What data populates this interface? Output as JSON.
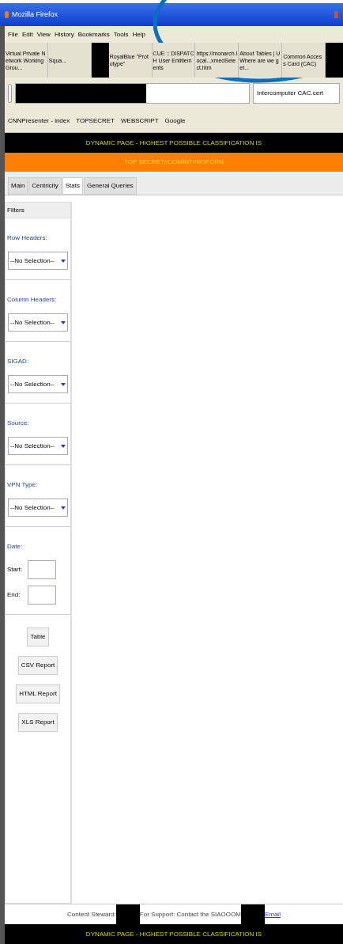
{
  "window": {
    "title": "Mozilla Firefox"
  },
  "menu": [
    "File",
    "Edit",
    "View",
    "History",
    "Bookmarks",
    "Tools",
    "Help"
  ],
  "browser_tabs": [
    {
      "kind": "tab",
      "label": "Virtual Private Network Working Grou..."
    },
    {
      "kind": "tab",
      "label": "Squa..."
    },
    {
      "kind": "redaction"
    },
    {
      "kind": "tab",
      "label": "RoyalBlue \"Prototype\""
    },
    {
      "kind": "tab",
      "label": "CUE :: DISPATCH User Entitlements"
    },
    {
      "kind": "tab",
      "label": "https://monarch.local...xmedSelect.htm"
    },
    {
      "kind": "tab",
      "label": "About Tables | U Where are we get..."
    },
    {
      "kind": "tab",
      "label": "Common Access Card (CAC)"
    },
    {
      "kind": "redaction"
    }
  ],
  "search_field": {
    "value": "Intercomputer CAC.cert"
  },
  "bookmarks": [
    "CNNPresenter - index",
    "TOPSECRET",
    "WEBSCRIPT",
    "Google"
  ],
  "banners": [
    {
      "kind": "classification",
      "text": "DYNAMIC PAGE - HIGHEST POSSIBLE CLASSIFICATION IS"
    },
    {
      "kind": "marking",
      "text": "TOP SECRET//COMINT//NOFORN"
    }
  ],
  "app_tabs": [
    {
      "label": "Main",
      "selected": false
    },
    {
      "label": "Centricity",
      "selected": false
    },
    {
      "label": "Stats",
      "selected": true
    },
    {
      "label": "General Queries",
      "selected": false
    }
  ],
  "filters": {
    "title": "Filters",
    "groups": [
      {
        "kind": "select",
        "legend": "Row Headers:",
        "value": "--No Selection--"
      },
      {
        "kind": "select",
        "legend": "Column Headers:",
        "value": "--No Selection--"
      },
      {
        "kind": "select",
        "legend": "SIGAD:",
        "value": "--No Selection--"
      },
      {
        "kind": "select",
        "legend": "Source:",
        "value": "--No Selection--"
      },
      {
        "kind": "select",
        "legend": "VPN Type:",
        "value": "--No Selection--"
      },
      {
        "kind": "dates",
        "legend": "Date:",
        "fields": [
          "Start:",
          "End:"
        ]
      }
    ],
    "buttons": [
      "Table",
      "CSV Report",
      "HTML Report",
      "XLS Report"
    ]
  },
  "footer": [
    {
      "kind": "text",
      "text": "Content Steward:"
    },
    {
      "kind": "redaction"
    },
    {
      "kind": "text",
      "text": "For Support: Contact the SIAOOOM"
    },
    {
      "kind": "redaction"
    },
    {
      "kind": "link",
      "text": "Email"
    }
  ],
  "bottom_banner": {
    "text": "DYNAMIC PAGE - HIGHEST POSSIBLE CLASSIFICATION IS"
  }
}
